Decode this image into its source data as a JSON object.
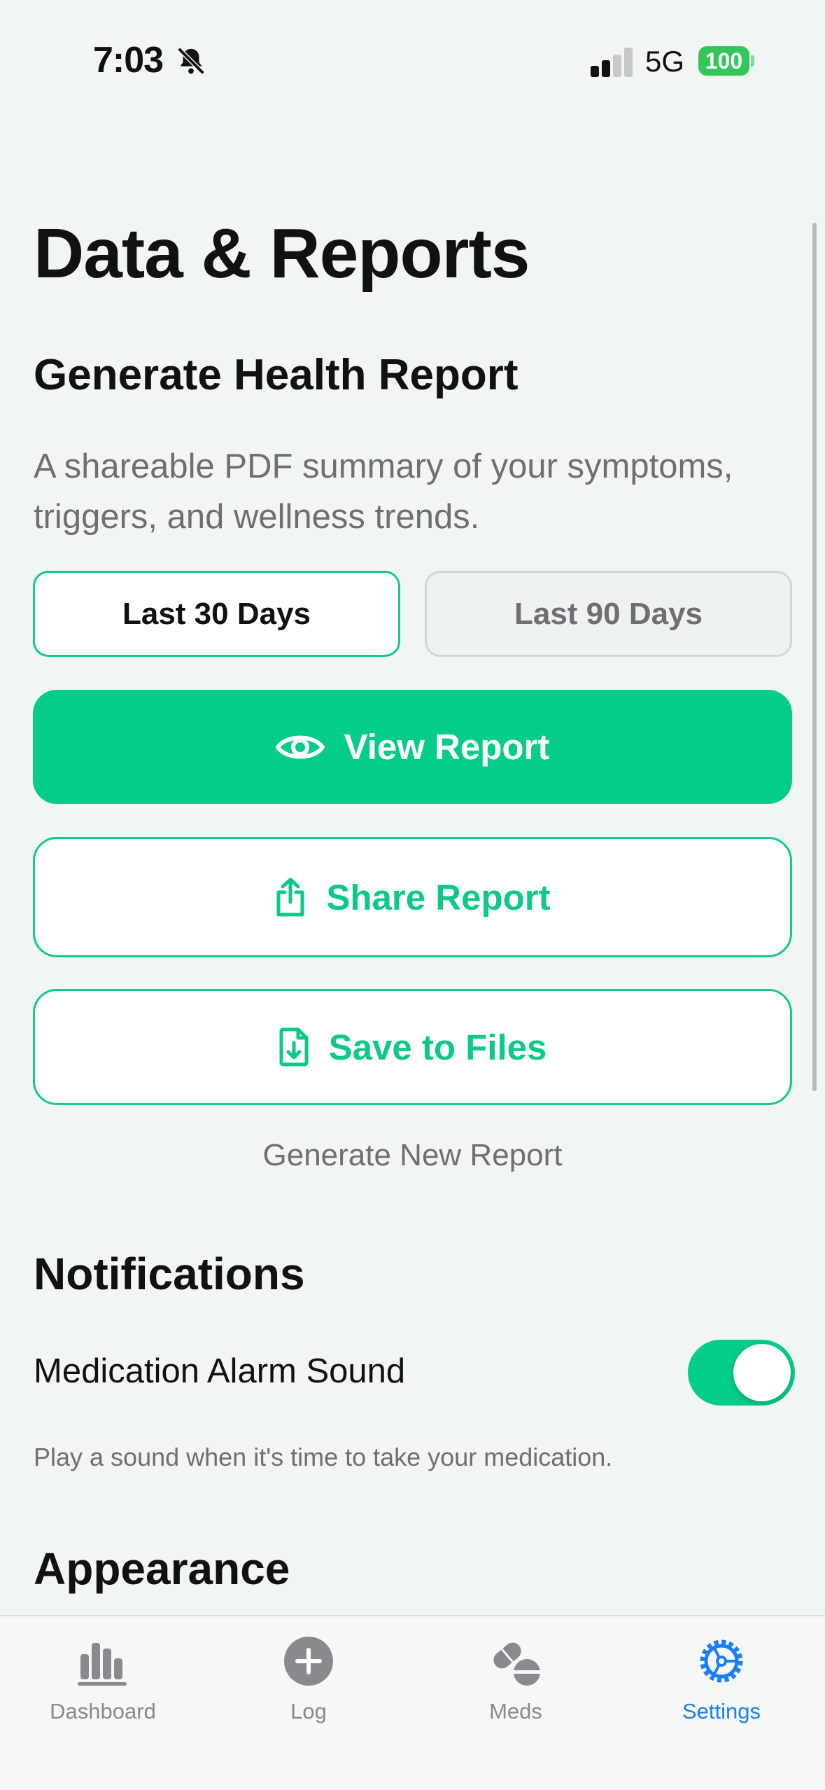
{
  "status_bar": {
    "time": "7:03",
    "network": "5G",
    "battery": "100",
    "colors": {
      "battery": "#33c759"
    }
  },
  "page": {
    "title": "Data & Reports"
  },
  "report": {
    "title": "Generate Health Report",
    "description": "A shareable PDF summary of your symptoms, triggers, and wellness trends.",
    "ranges": [
      {
        "label": "Last 30 Days",
        "selected": true
      },
      {
        "label": "Last 90 Days",
        "selected": false
      }
    ],
    "view_label": "View Report",
    "share_label": "Share Report",
    "save_label": "Save to Files",
    "generate_label": "Generate New Report",
    "icons": {
      "view": "eye-icon",
      "share": "share-icon",
      "save": "file-download-icon"
    }
  },
  "notifications": {
    "title": "Notifications",
    "alarm_label": "Medication Alarm Sound",
    "alarm_enabled": true,
    "alarm_help": "Play a sound when it's time to take your medication."
  },
  "appearance": {
    "title": "Appearance"
  },
  "tabs": [
    {
      "label": "Dashboard",
      "icon": "bar-chart-icon",
      "active": false
    },
    {
      "label": "Log",
      "icon": "plus-circle-icon",
      "active": false
    },
    {
      "label": "Meds",
      "icon": "pills-icon",
      "active": false
    },
    {
      "label": "Settings",
      "icon": "gear-icon",
      "active": true
    }
  ],
  "colors": {
    "accent": "#04cc89",
    "active_tab": "#1a7ef6"
  }
}
